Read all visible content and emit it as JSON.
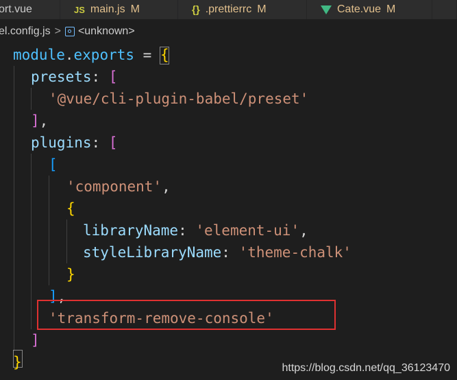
{
  "tabs": [
    {
      "label": "ort.vue",
      "icon": "",
      "modified": ""
    },
    {
      "label": "main.js",
      "icon": "JS",
      "modified": "M"
    },
    {
      "label": ".prettierrc",
      "icon": "{}",
      "modified": "M"
    },
    {
      "label": "Cate.vue",
      "icon": "vue-icon",
      "modified": "M"
    },
    {
      "label": "",
      "icon": "",
      "modified": ""
    }
  ],
  "breadcrumb": {
    "file": "el.config.js",
    "separator": ">",
    "symbol_icon": "symbol-variable-icon",
    "symbol": "<unknown>"
  },
  "code": {
    "line1": {
      "var": "module",
      "dot": ".",
      "prop": "exports",
      "op": " = ",
      "brace": "{"
    },
    "line2": {
      "key": "presets",
      "colon": ": ",
      "bracket": "["
    },
    "line3": {
      "str": "'@vue/cli-plugin-babel/preset'"
    },
    "line4": {
      "bracket": "]",
      "comma": ","
    },
    "line5": {
      "key": "plugins",
      "colon": ": ",
      "bracket": "["
    },
    "line6": {
      "bracket": "["
    },
    "line7": {
      "str": "'component'",
      "comma": ","
    },
    "line8": {
      "brace": "{"
    },
    "line9": {
      "key": "libraryName",
      "colon": ": ",
      "str": "'element-ui'",
      "comma": ","
    },
    "line10": {
      "key": "styleLibraryName",
      "colon": ": ",
      "str": "'theme-chalk'"
    },
    "line11": {
      "brace": "}"
    },
    "line12": {
      "bracket": "]",
      "comma": ","
    },
    "line13": {
      "str": "'transform-remove-console'"
    },
    "line14": {
      "bracket": "]"
    },
    "line15": {
      "brace": "}"
    }
  },
  "colors": {
    "background": "#1e1e1e",
    "string": "#ce9178",
    "property": "#9cdcfe",
    "highlight_box": "#e03131"
  },
  "watermark": "https://blog.csdn.net/qq_36123470"
}
